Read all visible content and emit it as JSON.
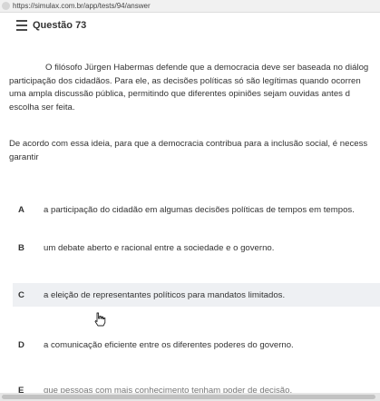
{
  "browser": {
    "url": "https://simulax.com.br/app/tests/94/answer"
  },
  "question": {
    "icon": "list-icon",
    "title": "Questão 73",
    "stem_lines": [
      "O filósofo Jürgen Habermas defende que a democracia deve ser baseada no diálog",
      "participação dos cidadãos. Para ele, as decisões políticas só são legítimas quando ocorren",
      "uma ampla discussão pública, permitindo que diferentes opiniões sejam ouvidas antes d",
      "escolha ser feita."
    ],
    "prompt_lines": [
      "De acordo com essa ideia, para que a democracia contribua para a inclusão social, é necess",
      "garantir"
    ]
  },
  "options": [
    {
      "letter": "A",
      "text": "a participação do cidadão em algumas decisões políticas de tempos em tempos."
    },
    {
      "letter": "B",
      "text": "um debate aberto e racional entre a sociedade e o governo."
    },
    {
      "letter": "C",
      "text": "a eleição de representantes políticos para mandatos limitados."
    },
    {
      "letter": "D",
      "text": "a comunicação eficiente entre os diferentes poderes do governo."
    },
    {
      "letter": "E",
      "text": "que pessoas com mais conhecimento tenham poder de decisão."
    }
  ],
  "colors": {
    "hover_row": "#eef0f3",
    "text": "#333333"
  }
}
